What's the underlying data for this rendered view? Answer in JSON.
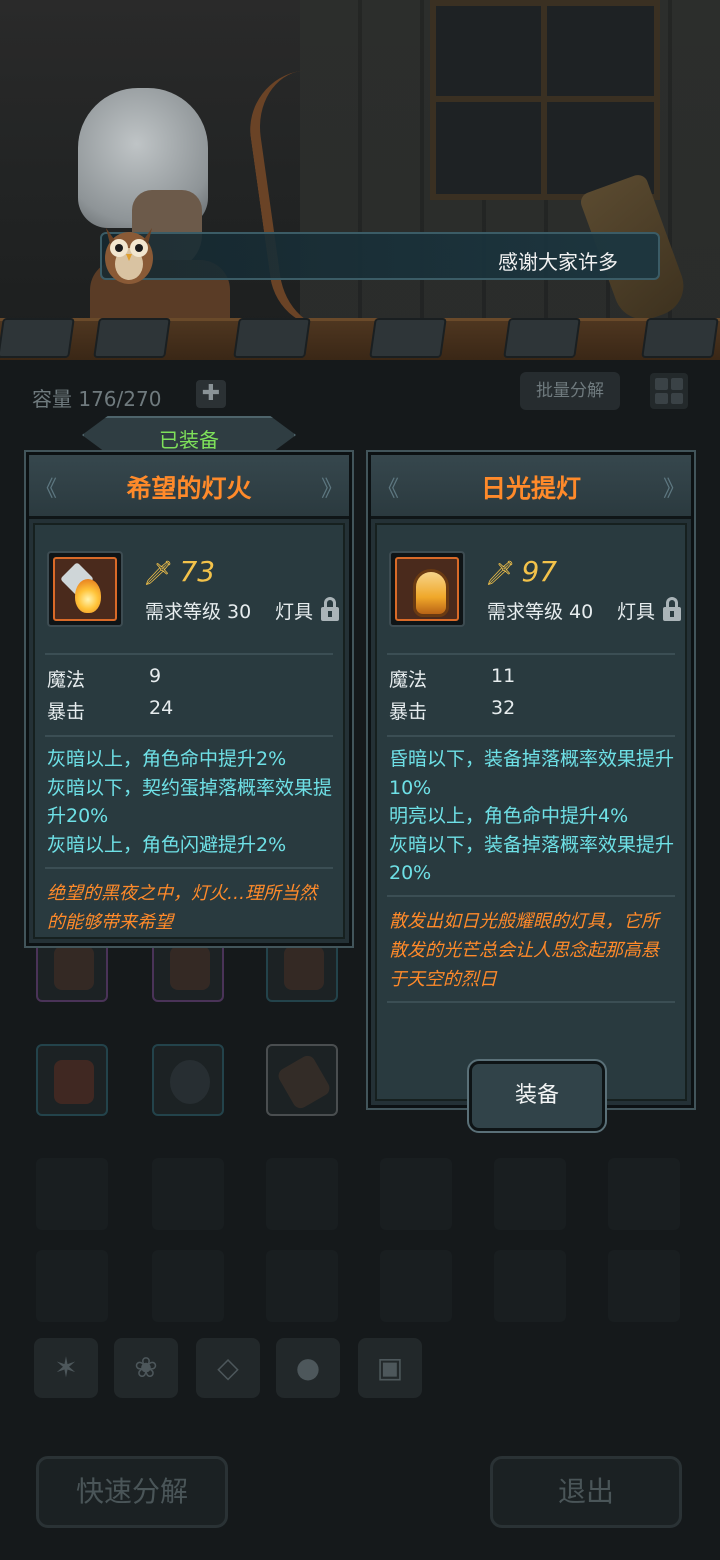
{
  "dialog": {
    "text": "感谢大家许多"
  },
  "inventory": {
    "capacity": "容量 176/270",
    "add_label": "✚",
    "batch_label": "批量分解",
    "quick_decompose": "快速分解",
    "exit": "退出"
  },
  "equipped_label": "已装备",
  "left_card": {
    "name": "希望的灯火",
    "power": "73",
    "req": "需求等级 30",
    "type": "灯具",
    "stats": [
      {
        "label": "魔法",
        "value": "9"
      },
      {
        "label": "暴击",
        "value": "24"
      }
    ],
    "effects": [
      "灰暗以上，角色命中提升2%",
      "灰暗以下，契约蛋掉落概率效果提升20%",
      "灰暗以上，角色闪避提升2%"
    ],
    "flavor": "绝望的黑夜之中，灯火…理所当然的能够带来希望"
  },
  "right_card": {
    "name": "日光提灯",
    "power": "97",
    "req": "需求等级 40",
    "type": "灯具",
    "stats": [
      {
        "label": "魔法",
        "value": "11"
      },
      {
        "label": "暴击",
        "value": "32"
      }
    ],
    "effects": [
      "昏暗以下，装备掉落概率效果提升10%",
      "明亮以上，角色命中提升4%",
      "灰暗以下，装备掉落概率效果提升20%"
    ],
    "flavor": "散发出如日光般耀眼的灯具，它所散发的光芒总会让人思念起那高悬于天空的烈日",
    "equip_label": "装备"
  },
  "colors": {
    "name": "#ff8a2a",
    "effect": "#6ee0e6",
    "power": "#f3c24a",
    "equipped": "#7ee05a"
  }
}
